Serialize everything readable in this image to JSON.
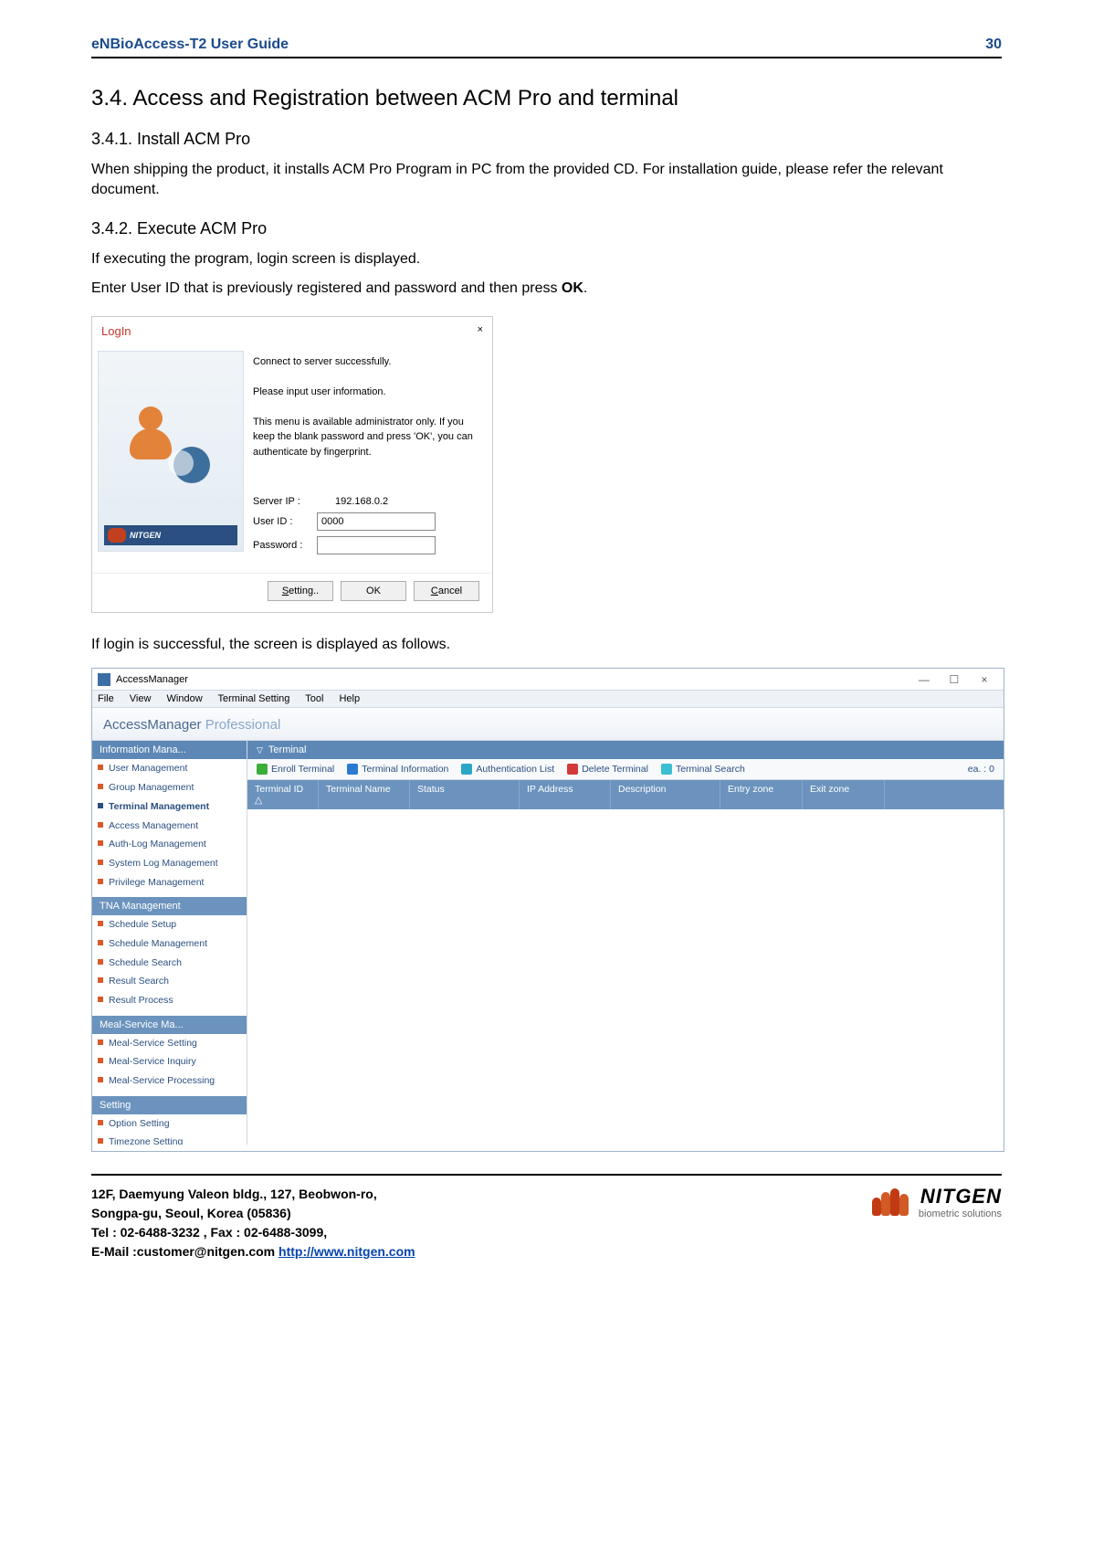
{
  "header": {
    "title": "eNBioAccess-T2 User Guide",
    "page": "30"
  },
  "sections": {
    "s34": "3.4.   Access and Registration between ACM Pro and terminal",
    "s341": "3.4.1. Install ACM Pro",
    "s341_body": "When shipping the product, it installs ACM Pro Program in PC from the provided CD. For installation guide, please refer the relevant document.",
    "s342": "3.4.2. Execute ACM Pro",
    "s342_body1": "If executing the program, login screen is displayed.",
    "s342_body2": "Enter User ID that is previously registered and password and then press ",
    "s342_body2_bold": "OK",
    "s342_body2_end": ".",
    "after_login": "If login is successful, the screen is displayed as follows."
  },
  "login": {
    "title": "LogIn",
    "close": "×",
    "msg1": "Connect to server successfully.",
    "msg2": "Please input user information.",
    "msg3": "This menu is available administrator only. If you keep the blank password and press 'OK', you can authenticate by fingerprint.",
    "nitgen": "NITGEN",
    "nitgen_sub": "biometric solutions",
    "server_ip_label": "Server IP :",
    "server_ip": "192.168.0.2",
    "user_id_label": "User ID :",
    "user_id": "0000",
    "password_label": "Password :",
    "btn_setting": "etting..",
    "btn_setting_ul": "S",
    "btn_ok": "OK",
    "btn_cancel": "ancel",
    "btn_cancel_ul": "C"
  },
  "am": {
    "title": "AccessManager",
    "win_min": "—",
    "win_max": "☐",
    "win_close": "×",
    "menu": [
      "File",
      "View",
      "Window",
      "Terminal Setting",
      "Tool",
      "Help"
    ],
    "brand1": "AccessManager",
    "brand2": " Professional",
    "side": {
      "info_head": "Information Mana...",
      "info_items": [
        "User Management",
        "Group Management",
        "Terminal Management",
        "Access Management",
        "Auth-Log Management",
        "System Log Management",
        "Privilege Management"
      ],
      "tna_head": "TNA Management",
      "tna_items": [
        "Schedule Setup",
        "Schedule Management",
        "Schedule Search",
        "Result  Search",
        "Result Process"
      ],
      "meal_head": "Meal-Service Ma...",
      "meal_items": [
        "Meal-Service Setting",
        "Meal-Service Inquiry",
        "Meal-Service Processing"
      ],
      "setting_head": "Setting",
      "setting_items": [
        "Option Setting",
        "Timezone Setting"
      ]
    },
    "content_head": "Terminal",
    "toolbar": {
      "enroll": "Enroll Terminal",
      "info": "Terminal Information",
      "auth": "Authentication List",
      "delete": "Delete Terminal",
      "search": "Terminal Search",
      "ea": "ea.  :  0"
    },
    "grid": [
      "Terminal ID △",
      "Terminal Name",
      "Status",
      "IP Address",
      "Description",
      "Entry zone",
      "Exit zone"
    ]
  },
  "footer": {
    "l1": "12F, Daemyung Valeon bldg., 127, Beobwon-ro,",
    "l2": "Songpa-gu, Seoul, Korea (05836)",
    "l3": "Tel : 02-6488-3232 , Fax : 02-6488-3099,",
    "l4a": "E-Mail :customer@nitgen.com ",
    "l4b": "http://www.nitgen.com",
    "logo": "NITGEN",
    "logo_sub": "biometric solutions"
  }
}
